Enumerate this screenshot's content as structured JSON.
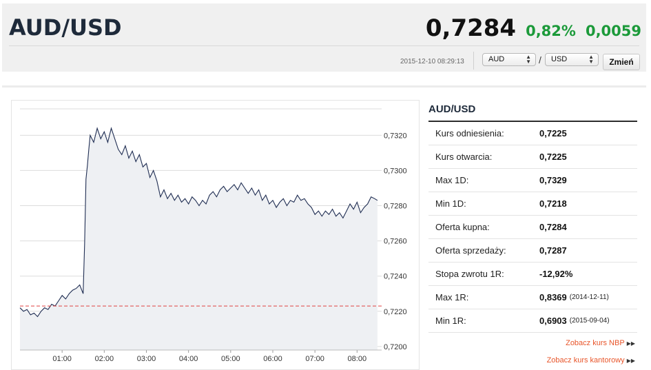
{
  "header": {
    "pair": "AUD/USD",
    "price": "0,7284",
    "change_pct": "0,82%",
    "change_abs": "0,0059",
    "timestamp": "2015-12-10 08:29:13",
    "from_currency": "AUD",
    "to_currency": "USD",
    "separator": "/",
    "change_button": "Zmień"
  },
  "info": {
    "title": "AUD/USD",
    "rows": [
      {
        "label": "Kurs odniesienia:",
        "value": "0,7225",
        "note": ""
      },
      {
        "label": "Kurs otwarcia:",
        "value": "0,7225",
        "note": ""
      },
      {
        "label": "Max 1D:",
        "value": "0,7329",
        "note": ""
      },
      {
        "label": "Min 1D:",
        "value": "0,7218",
        "note": ""
      },
      {
        "label": "Oferta kupna:",
        "value": "0,7284",
        "note": ""
      },
      {
        "label": "Oferta sprzedaży:",
        "value": "0,7287",
        "note": ""
      },
      {
        "label": "Stopa zwrotu 1R:",
        "value": "-12,92%",
        "note": ""
      },
      {
        "label": "Max 1R:",
        "value": "0,8369",
        "note": "(2014-12-11)"
      },
      {
        "label": "Min 1R:",
        "value": "0,6903",
        "note": "(2015-09-04)"
      }
    ],
    "link_nbp": "Zobacz kurs NBP",
    "link_exchange": "Zobacz kurs kantorowy"
  },
  "colors": {
    "positive": "#1c9a3a",
    "line": "#1f2d52",
    "reference_line": "#e04040",
    "link": "#e8552a"
  },
  "chart_data": {
    "type": "line",
    "title": "",
    "xlabel": "",
    "ylabel": "",
    "x_ticks": [
      "01:00",
      "02:00",
      "03:00",
      "04:00",
      "05:00",
      "06:00",
      "07:00",
      "08:00"
    ],
    "y_ticks": [
      "0,7200",
      "0,7220",
      "0,7240",
      "0,7260",
      "0,7280",
      "0,7300",
      "0,7320"
    ],
    "ylim": [
      0.7198,
      0.7335
    ],
    "xlim": [
      "00:00",
      "08:35"
    ],
    "reference_value": 0.7223,
    "grid": true,
    "series": [
      {
        "x": [
          "00:00",
          "00:05",
          "00:10",
          "00:15",
          "00:20",
          "00:25",
          "00:30",
          "00:35",
          "00:40",
          "00:45",
          "00:50",
          "00:55",
          "01:00",
          "01:05",
          "01:10",
          "01:15",
          "01:20",
          "01:25",
          "01:30",
          "01:32",
          "01:34",
          "01:36",
          "01:38",
          "01:40",
          "01:45",
          "01:50",
          "01:55",
          "02:00",
          "02:05",
          "02:10",
          "02:15",
          "02:20",
          "02:25",
          "02:30",
          "02:35",
          "02:40",
          "02:45",
          "02:50",
          "02:55",
          "03:00",
          "03:05",
          "03:10",
          "03:15",
          "03:20",
          "03:25",
          "03:30",
          "03:35",
          "03:40",
          "03:45",
          "03:50",
          "03:55",
          "04:00",
          "04:05",
          "04:10",
          "04:15",
          "04:20",
          "04:25",
          "04:30",
          "04:35",
          "04:40",
          "04:45",
          "04:50",
          "04:55",
          "05:00",
          "05:05",
          "05:10",
          "05:15",
          "05:20",
          "05:25",
          "05:30",
          "05:35",
          "05:40",
          "05:45",
          "05:50",
          "05:55",
          "06:00",
          "06:05",
          "06:10",
          "06:15",
          "06:20",
          "06:25",
          "06:30",
          "06:35",
          "06:40",
          "06:45",
          "06:50",
          "06:55",
          "07:00",
          "07:05",
          "07:10",
          "07:15",
          "07:20",
          "07:25",
          "07:30",
          "07:35",
          "07:40",
          "07:45",
          "07:50",
          "07:55",
          "08:00",
          "08:05",
          "08:10",
          "08:15",
          "08:20",
          "08:25",
          "08:29"
        ],
        "y": [
          0.7222,
          0.722,
          0.7221,
          0.7218,
          0.7219,
          0.7217,
          0.722,
          0.7222,
          0.7221,
          0.7224,
          0.7223,
          0.7226,
          0.7229,
          0.7227,
          0.723,
          0.7232,
          0.7233,
          0.7235,
          0.723,
          0.7258,
          0.7295,
          0.7303,
          0.7312,
          0.732,
          0.7316,
          0.7324,
          0.7318,
          0.7322,
          0.7316,
          0.7324,
          0.7318,
          0.7312,
          0.7309,
          0.7314,
          0.7307,
          0.7311,
          0.7305,
          0.7309,
          0.7302,
          0.7304,
          0.7296,
          0.73,
          0.7294,
          0.7285,
          0.7289,
          0.7284,
          0.7287,
          0.7283,
          0.7286,
          0.7282,
          0.7284,
          0.7281,
          0.7285,
          0.7283,
          0.728,
          0.7283,
          0.7281,
          0.7286,
          0.7288,
          0.7285,
          0.7289,
          0.7291,
          0.7288,
          0.729,
          0.7292,
          0.7289,
          0.7293,
          0.729,
          0.7287,
          0.729,
          0.7286,
          0.7289,
          0.7283,
          0.7286,
          0.7281,
          0.7283,
          0.7279,
          0.7282,
          0.7284,
          0.728,
          0.7283,
          0.7282,
          0.7286,
          0.7283,
          0.7284,
          0.7281,
          0.7279,
          0.7275,
          0.7277,
          0.7274,
          0.7277,
          0.7275,
          0.7278,
          0.7274,
          0.7276,
          0.7273,
          0.7277,
          0.7281,
          0.7278,
          0.7282,
          0.7276,
          0.7279,
          0.7281,
          0.7285,
          0.7284,
          0.7283
        ]
      }
    ]
  }
}
